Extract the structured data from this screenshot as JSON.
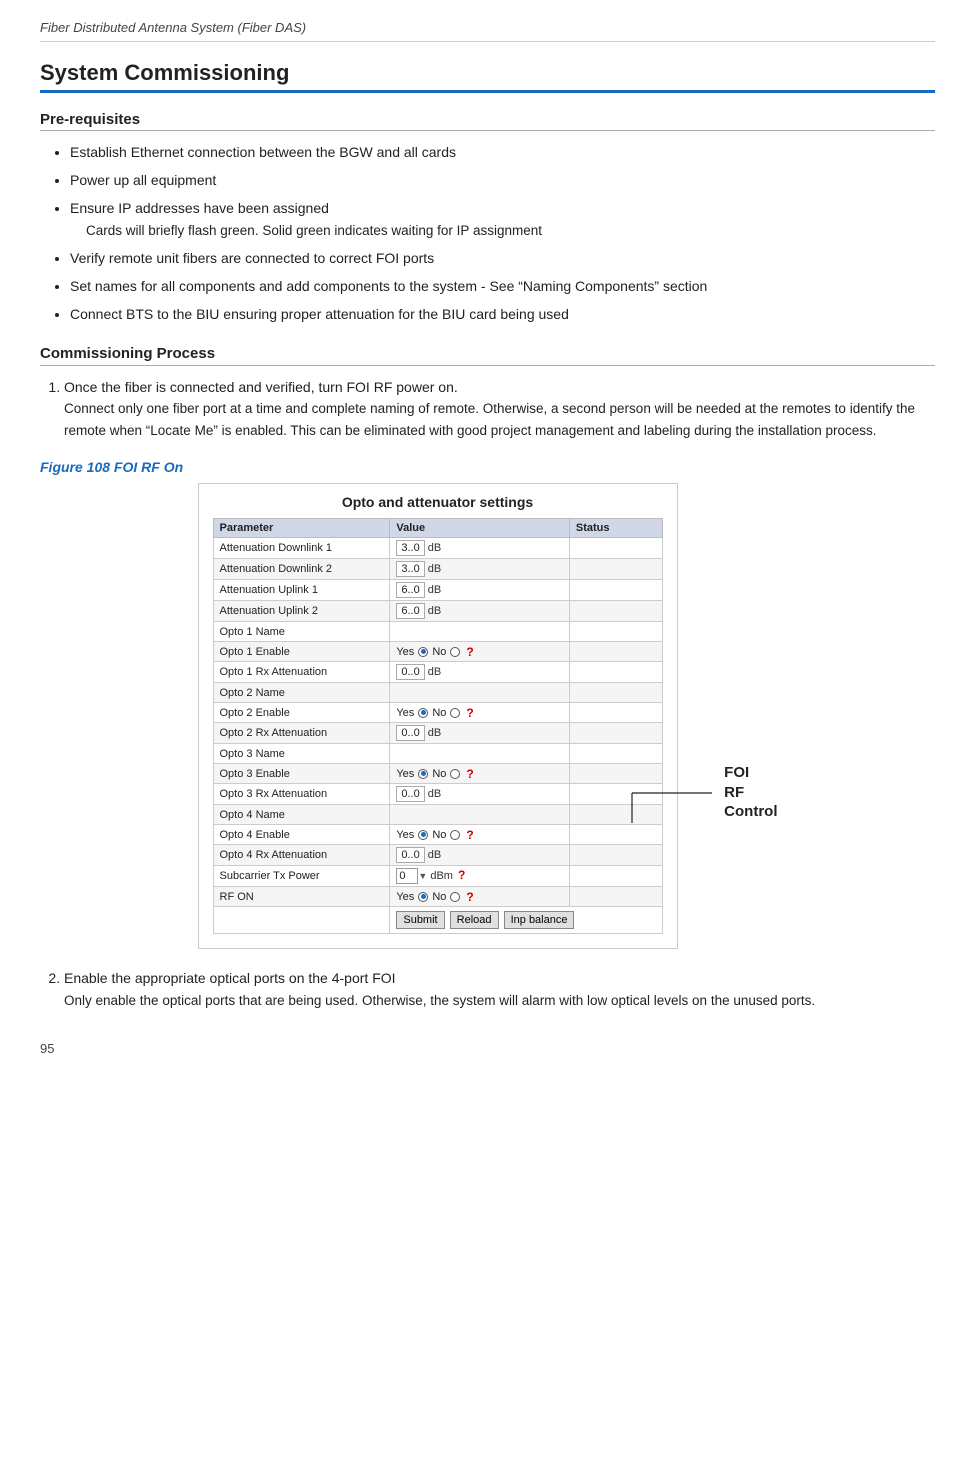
{
  "doc": {
    "title": "Fiber Distributed Antenna System (Fiber DAS)",
    "page_number": "95"
  },
  "section": {
    "main_title": "System Commissioning",
    "prereq": {
      "heading": "Pre-requisites",
      "items": [
        {
          "text": "Establish Ethernet connection between the BGW and all cards",
          "sub": ""
        },
        {
          "text": "Power up all equipment",
          "sub": ""
        },
        {
          "text": "Ensure IP addresses have been assigned",
          "sub": "Cards will briefly flash green.  Solid green indicates waiting for IP assignment"
        },
        {
          "text": "Verify remote unit fibers are connected to correct FOI ports",
          "sub": ""
        },
        {
          "text": "Set names for all components and add components to the system - See “Naming Components” section",
          "sub": ""
        },
        {
          "text": "Connect BTS to the BIU ensuring proper attenuation for the BIU card being used",
          "sub": ""
        }
      ]
    },
    "commissioning": {
      "heading": "Commissioning Process",
      "steps": [
        {
          "number": "1.",
          "text": "Once the fiber is connected and verified, turn FOI RF power on.",
          "sub": "Connect only one fiber port at a time and complete naming of remote. Otherwise, a second person will be needed at the remotes to identify the remote when “Locate Me” is enabled. This can be eliminated with good project management and labeling during the installation process."
        },
        {
          "number": "2.",
          "text": "Enable the appropriate optical ports on the 4-port FOI",
          "sub": "Only enable the optical ports that are being used. Otherwise, the system will alarm with low optical levels on the unused ports."
        }
      ]
    },
    "figure": {
      "label": "Figure 108   FOI RF On",
      "box_title": "Opto and attenuator settings",
      "annotation": "FOI\nRF\nControl",
      "table": {
        "headers": [
          "Parameter",
          "Value",
          "Status"
        ],
        "rows": [
          [
            "Attenuation Downlink 1",
            "3..0  dB",
            ""
          ],
          [
            "Attenuation Downlink 2",
            "3..0  dB",
            ""
          ],
          [
            "Attenuation Uplink 1",
            "6..0  dB",
            ""
          ],
          [
            "Attenuation Uplink 2",
            "6..0  dB",
            ""
          ],
          [
            "Opto 1 Name",
            "",
            ""
          ],
          [
            "Opto 1 Enable",
            "Yes ● No ○ ?",
            ""
          ],
          [
            "Opto 1 Rx Attenuation",
            "0..0  dB",
            ""
          ],
          [
            "Opto 2 Name",
            "",
            ""
          ],
          [
            "Opto 2 Enable",
            "Yes ● No ○ ?",
            ""
          ],
          [
            "Opto 2 Rx Attenuation",
            "0..0  dB",
            ""
          ],
          [
            "Opto 3 Name",
            "",
            ""
          ],
          [
            "Opto 3 Enable",
            "Yes ● No ○ ?",
            ""
          ],
          [
            "Opto 3 Rx Attenuation",
            "0..0  dB",
            ""
          ],
          [
            "Opto 4 Name",
            "",
            ""
          ],
          [
            "Opto 4 Enable",
            "Yes ● No ○ ?",
            ""
          ],
          [
            "Opto 4 Rx Attenuation",
            "0..0  dB",
            ""
          ],
          [
            "Subcarrier Tx Power",
            "0 ▼ dBm",
            ""
          ],
          [
            "RF ON",
            "Yes ● No ○ ?",
            ""
          ]
        ],
        "buttons": [
          "Submit",
          "Reload",
          "Inp balance"
        ]
      }
    }
  }
}
